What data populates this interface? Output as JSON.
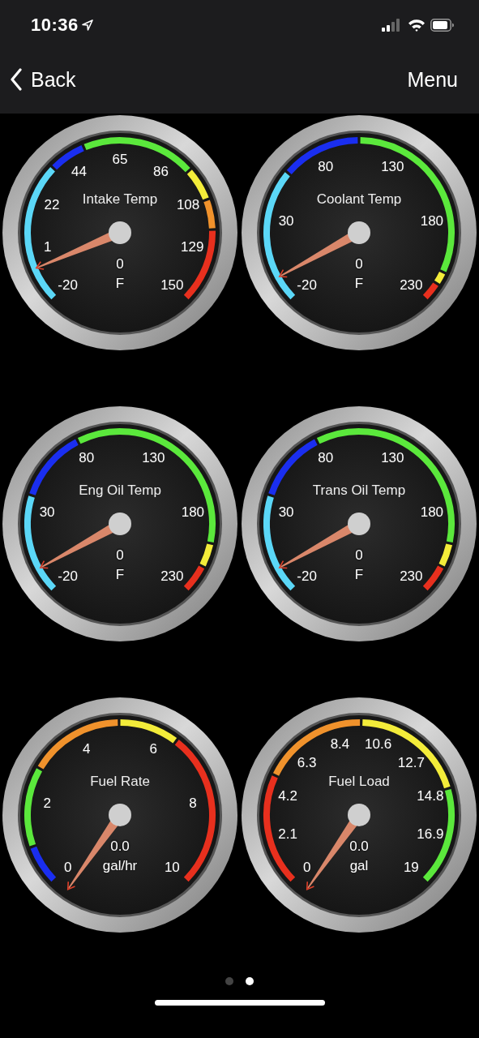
{
  "status_bar": {
    "time": "10:36"
  },
  "nav_bar": {
    "back": "Back",
    "menu": "Menu"
  },
  "gauges": [
    {
      "title": "Intake Temp",
      "scale": [
        "-20",
        "1",
        "22",
        "44",
        "65",
        "86",
        "108",
        "129",
        "150"
      ],
      "reading": "0",
      "unit": "F",
      "zones": [
        {
          "color": "#5bd7f7"
        },
        {
          "color": "#1a2ef0"
        },
        {
          "color": "#5be83c"
        },
        {
          "color": "#f3ec3a"
        },
        {
          "color": "#f0922c"
        },
        {
          "color": "#e8301e"
        }
      ]
    },
    {
      "title": "Coolant Temp",
      "scale": [
        "-20",
        "30",
        "80",
        "130",
        "180",
        "230"
      ],
      "reading": "0",
      "unit": "F",
      "zones": [
        {
          "color": "#5bd7f7"
        },
        {
          "color": "#1a2ef0"
        },
        {
          "color": "#5be83c"
        },
        {
          "color": "#f3ec3a"
        },
        {
          "color": "#e8301e"
        }
      ]
    },
    {
      "title": "Eng Oil Temp",
      "scale": [
        "-20",
        "30",
        "80",
        "130",
        "180",
        "230"
      ],
      "reading": "0",
      "unit": "F",
      "zones": [
        {
          "color": "#5bd7f7"
        },
        {
          "color": "#1a2ef0"
        },
        {
          "color": "#5be83c"
        },
        {
          "color": "#f3ec3a"
        },
        {
          "color": "#e8301e"
        }
      ]
    },
    {
      "title": "Trans Oil Temp",
      "scale": [
        "-20",
        "30",
        "80",
        "130",
        "180",
        "230"
      ],
      "reading": "0",
      "unit": "F",
      "zones": [
        {
          "color": "#5bd7f7"
        },
        {
          "color": "#1a2ef0"
        },
        {
          "color": "#5be83c"
        },
        {
          "color": "#f3ec3a"
        },
        {
          "color": "#e8301e"
        }
      ]
    },
    {
      "title": "Fuel Rate",
      "scale": [
        "0",
        "2",
        "4",
        "6",
        "8",
        "10"
      ],
      "reading": "0.0",
      "unit": "gal/hr",
      "zones": [
        {
          "color": "#1a2ef0"
        },
        {
          "color": "#5be83c"
        },
        {
          "color": "#f0922c"
        },
        {
          "color": "#f3ec3a"
        },
        {
          "color": "#e8301e"
        }
      ]
    },
    {
      "title": "Fuel Load",
      "scale": [
        "0",
        "2.1",
        "4.2",
        "6.3",
        "8.4",
        "10.6",
        "12.7",
        "14.8",
        "16.9",
        "19"
      ],
      "reading": "0.0",
      "unit": "gal",
      "zones": [
        {
          "color": "#e8301e"
        },
        {
          "color": "#f0922c"
        },
        {
          "color": "#f3ec3a"
        },
        {
          "color": "#5be83c"
        }
      ]
    }
  ],
  "page_dots": [
    {
      "selected": false
    },
    {
      "selected": true
    }
  ]
}
